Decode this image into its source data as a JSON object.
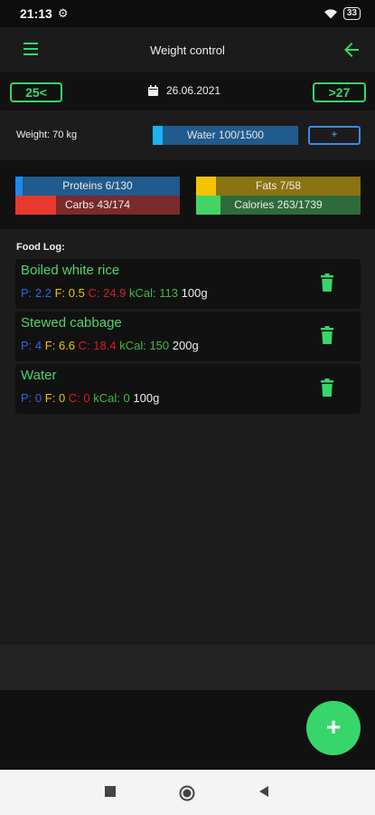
{
  "status_bar": {
    "time": "21:13",
    "battery": "33"
  },
  "app_bar": {
    "title": "Weight control"
  },
  "date_nav": {
    "prev_label": "25<",
    "date": "26.06.2021",
    "next_label": ">27"
  },
  "weight": {
    "label": "Weight: 70 kg"
  },
  "water": {
    "label": "Water 100/1500",
    "progress": 0.067,
    "add_label": "+",
    "bar_color": "#215a8c",
    "fill_color": "#1ab3f0"
  },
  "macros": {
    "proteins": {
      "label": "Proteins 6/130",
      "progress": 0.046,
      "bar_color": "#215a8c",
      "fill_color": "#1a8cf0"
    },
    "fats": {
      "label": "Fats 7/58",
      "progress": 0.121,
      "bar_color": "#8a7310",
      "fill_color": "#f5c400"
    },
    "carbs": {
      "label": "Carbs 43/174",
      "progress": 0.247,
      "bar_color": "#7a2a2a",
      "fill_color": "#e8392f"
    },
    "calories": {
      "label": "Calories 263/1739",
      "progress": 0.151,
      "bar_color": "#2f6b3a",
      "fill_color": "#44d466"
    }
  },
  "food_log": {
    "title": "Food Log:",
    "items": [
      {
        "name": "Boiled white rice",
        "p": "2.2",
        "f": "0.5",
        "c": "24.9",
        "kcal": "113",
        "weight": "100g"
      },
      {
        "name": "Stewed cabbage",
        "p": "4",
        "f": "6.6",
        "c": "18.4",
        "kcal": "150",
        "weight": "200g"
      },
      {
        "name": "Water",
        "p": "0",
        "f": "0",
        "c": "0",
        "kcal": "0",
        "weight": "100g"
      }
    ]
  },
  "fab": {
    "label": "+"
  },
  "colors": {
    "accent": "#37d66a",
    "protein": "#2c66e0",
    "fat": "#f0c400",
    "carb": "#d02020",
    "kcal": "#3fb93f"
  },
  "icons": {
    "menu": "menu-icon",
    "back": "arrow-left-icon",
    "calendar": "calendar-icon",
    "trash": "trash-icon",
    "add": "plus-icon"
  }
}
